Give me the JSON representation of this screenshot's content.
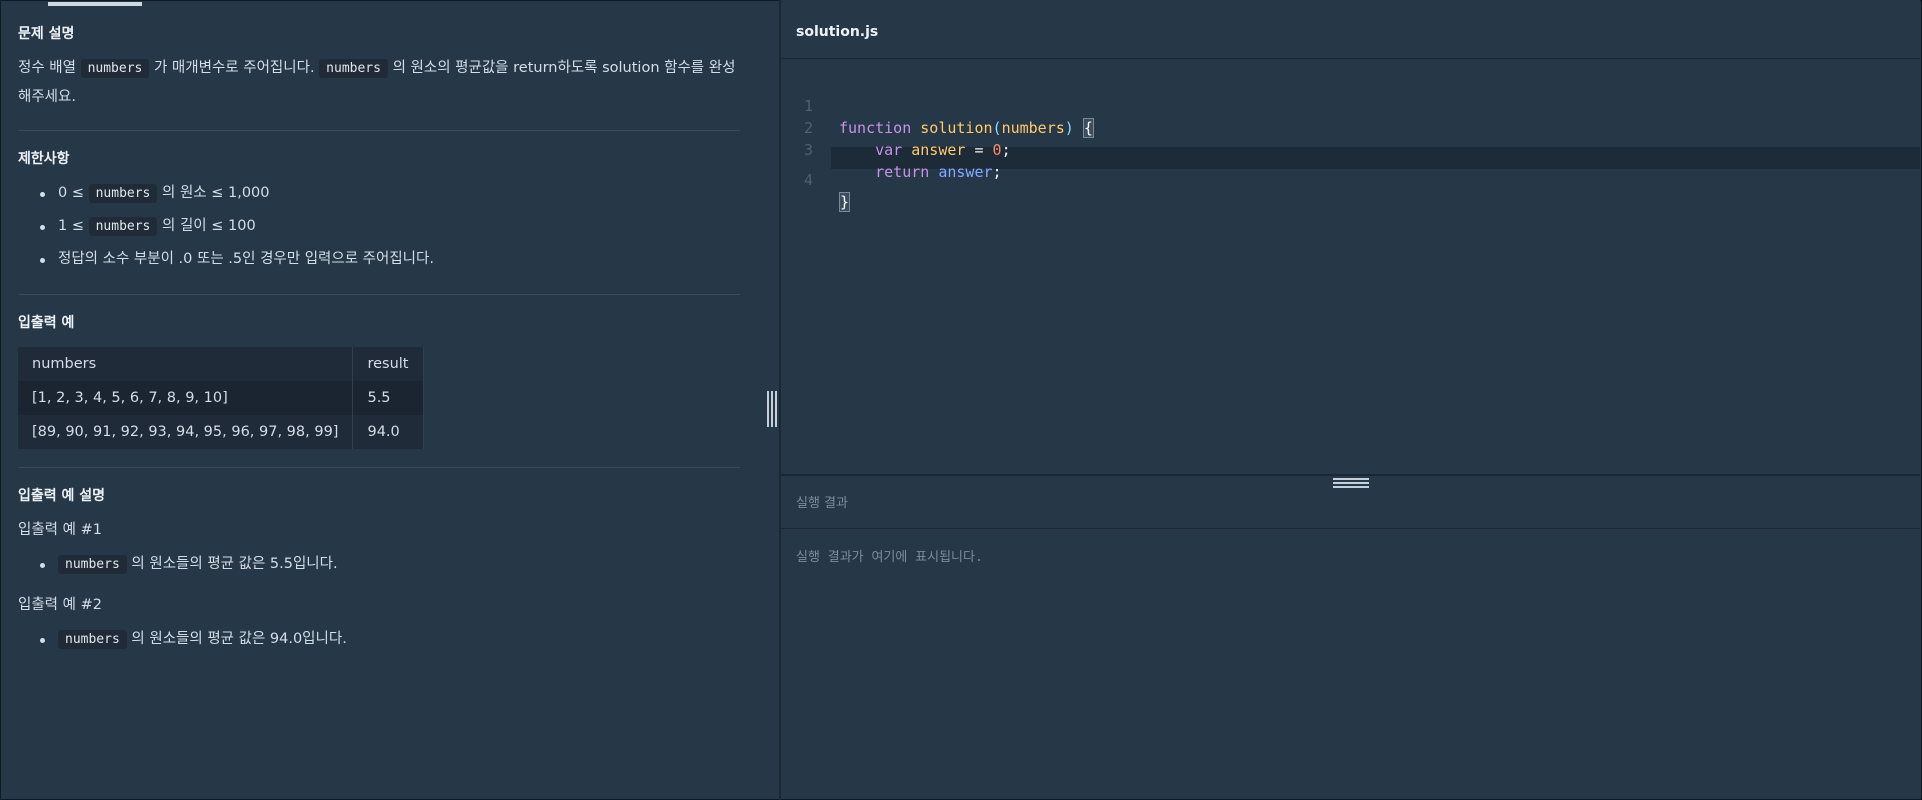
{
  "problem": {
    "description_heading": "문제 설명",
    "description": {
      "part1": "정수 배열 ",
      "code1": "numbers",
      "part2": " 가 매개변수로 주어집니다. ",
      "code2": "numbers",
      "part3": " 의 원소의 평균값을 return하도록 solution 함수를 완성해주세요."
    },
    "constraints_heading": "제한사항",
    "constraints": [
      {
        "pre": "0 ≤ ",
        "code": "numbers",
        "post": " 의 원소 ≤ 1,000"
      },
      {
        "pre": "1 ≤ ",
        "code": "numbers",
        "post": " 의 길이 ≤ 100"
      },
      {
        "pre": "정답의 소수 부분이 .0 또는 .5인 경우만 입력으로 주어집니다.",
        "code": "",
        "post": ""
      }
    ],
    "io_heading": "입출력 예",
    "io_table": {
      "headers": [
        "numbers",
        "result"
      ],
      "rows": [
        [
          "[1, 2, 3, 4, 5, 6, 7, 8, 9, 10]",
          "5.5"
        ],
        [
          "[89, 90, 91, 92, 93, 94, 95, 96, 97, 98, 99]",
          "94.0"
        ]
      ]
    },
    "io_desc_heading": "입출력 예 설명",
    "examples": [
      {
        "title": "입출력 예 #1",
        "code": "numbers",
        "text": " 의 원소들의 평균 값은 5.5입니다."
      },
      {
        "title": "입출력 예 #2",
        "code": "numbers",
        "text": " 의 원소들의 평균 값은 94.0입니다."
      }
    ]
  },
  "editor": {
    "filename": "solution.js",
    "line_numbers": [
      "1",
      "2",
      "3",
      "4"
    ],
    "tokens": {
      "function_kw": "function",
      "fn_name": "solution",
      "open_paren": "(",
      "param": "numbers",
      "close_paren": ")",
      "open_brace": "{",
      "var_kw": "var",
      "var_name": "answer",
      "assign": " = ",
      "zero": "0",
      "semicolon": ";",
      "return_kw": "return",
      "return_val": "answer",
      "close_brace": "}"
    }
  },
  "result": {
    "title": "실행 결과",
    "placeholder": "실행 결과가 여기에 표시됩니다."
  }
}
